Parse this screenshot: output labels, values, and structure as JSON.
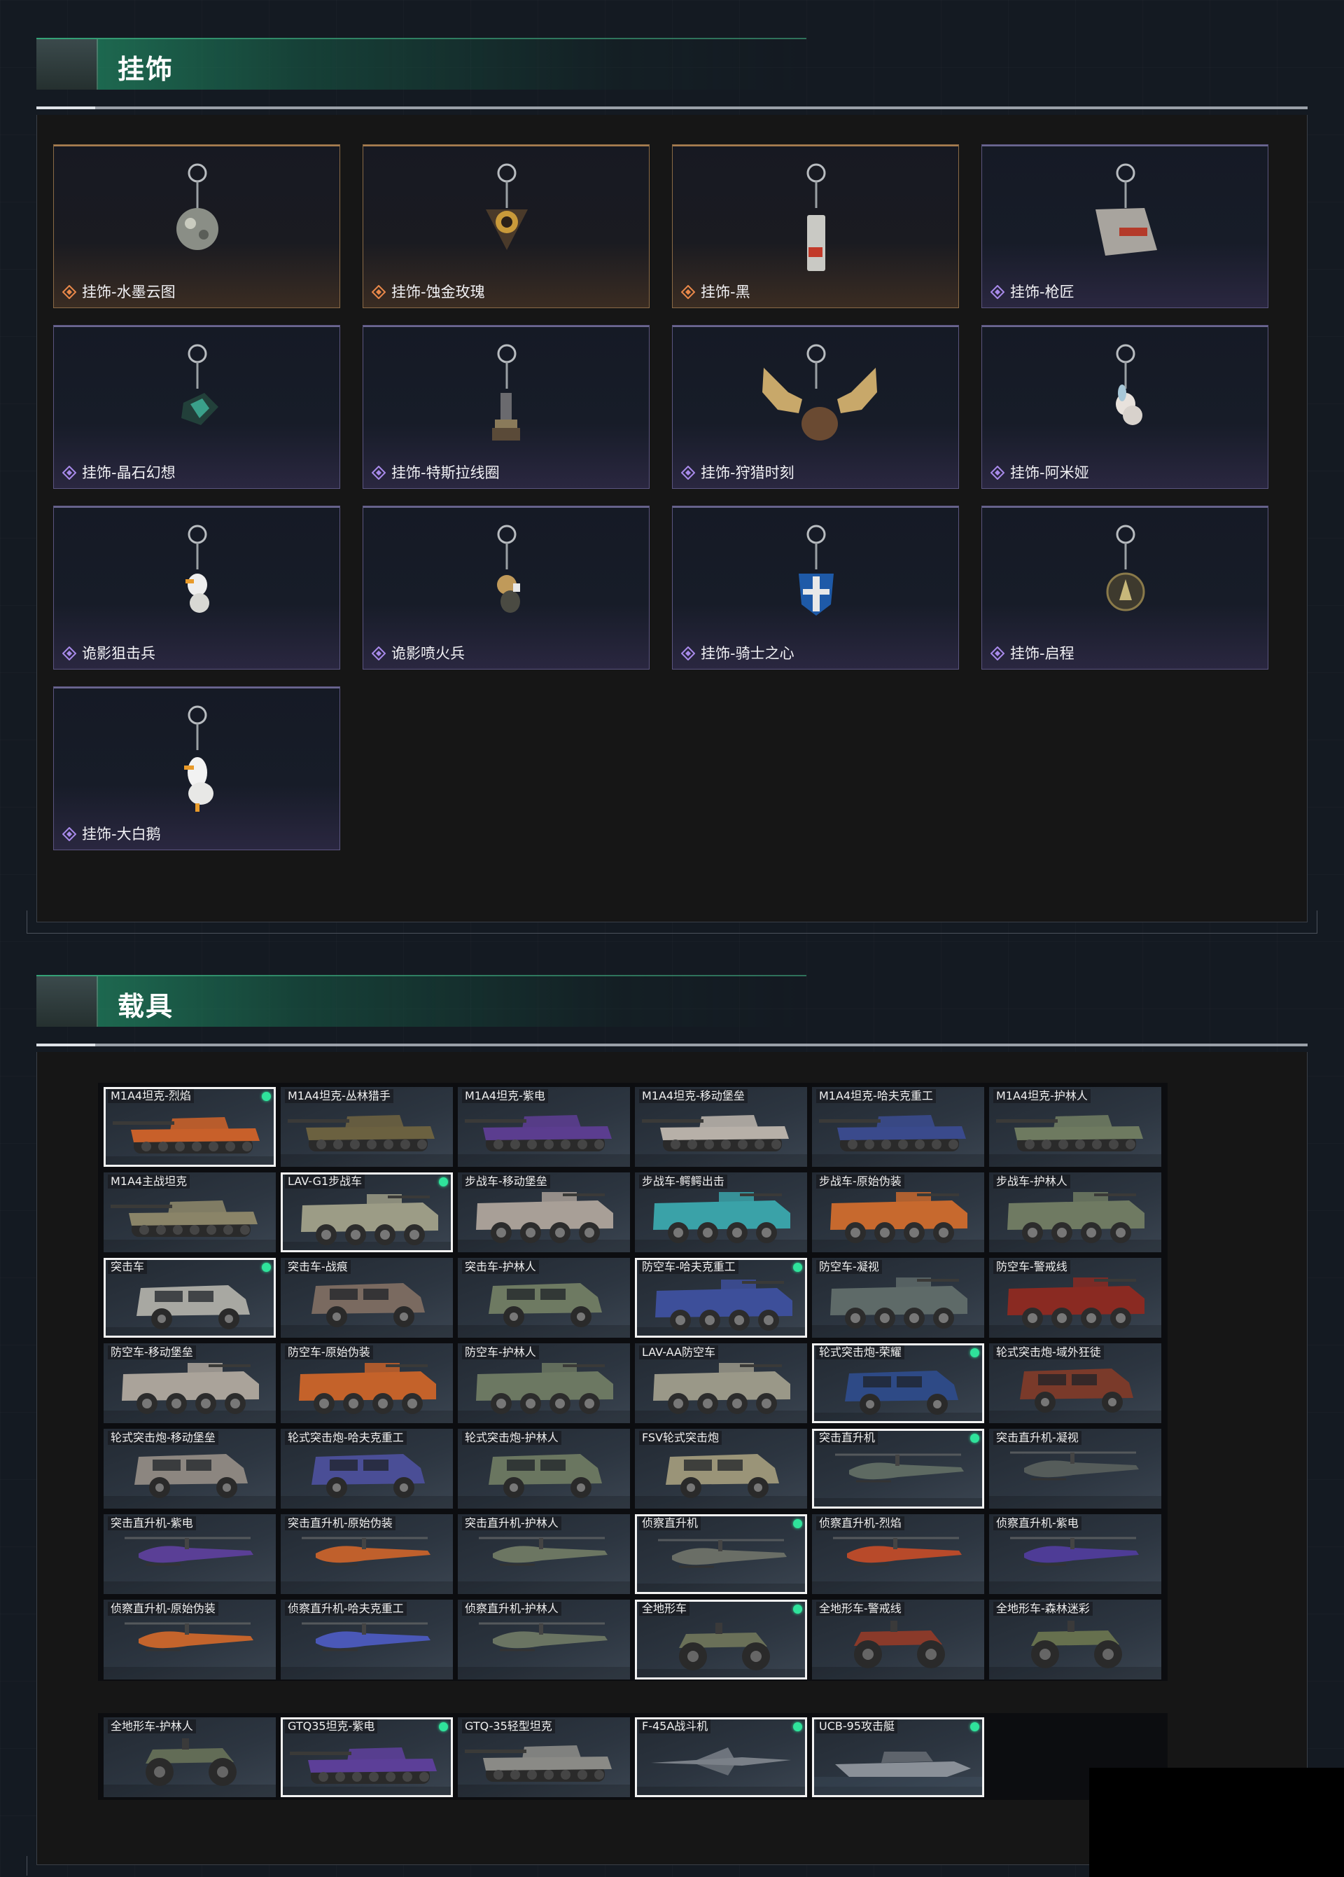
{
  "pendant_section": {
    "title": "挂饰",
    "items": [
      {
        "label": "挂饰-水墨云图",
        "rarity": "gold",
        "icon": "orb-pendant-icon"
      },
      {
        "label": "挂饰-蚀金玫瑰",
        "rarity": "gold",
        "icon": "rose-emblem-pendant-icon"
      },
      {
        "label": "挂饰-黑",
        "rarity": "gold",
        "icon": "card-pendant-icon"
      },
      {
        "label": "挂饰-枪匠",
        "rarity": "purple",
        "icon": "toolbox-pendant-icon"
      },
      {
        "label": "挂饰-晶石幻想",
        "rarity": "purple",
        "icon": "crystal-cube-pendant-icon"
      },
      {
        "label": "挂饰-特斯拉线圈",
        "rarity": "purple",
        "icon": "tesla-coil-pendant-icon"
      },
      {
        "label": "挂饰-狩猎时刻",
        "rarity": "purple",
        "icon": "moose-antler-pendant-icon"
      },
      {
        "label": "挂饰-阿米娅",
        "rarity": "purple",
        "icon": "bunny-pendant-icon"
      },
      {
        "label": "诡影狙击兵",
        "rarity": "purple",
        "icon": "goose-sniper-pendant-icon"
      },
      {
        "label": "诡影喷火兵",
        "rarity": "purple",
        "icon": "goose-flamer-pendant-icon"
      },
      {
        "label": "挂饰-骑士之心",
        "rarity": "purple",
        "icon": "shield-pendant-icon"
      },
      {
        "label": "挂饰-启程",
        "rarity": "purple",
        "icon": "medal-pendant-icon"
      },
      {
        "label": "挂饰-大白鹅",
        "rarity": "purple",
        "icon": "white-goose-pendant-icon"
      }
    ]
  },
  "vehicle_section": {
    "title": "载具",
    "rows": [
      [
        {
          "label": "M1A4坦克-烈焰",
          "selected": true,
          "owned": true,
          "kind": "tank",
          "color": "#c8602a"
        },
        {
          "label": "M1A4坦克-丛林猎手",
          "selected": false,
          "owned": false,
          "kind": "tank",
          "color": "#6b6140"
        },
        {
          "label": "M1A4坦克-紫电",
          "selected": false,
          "owned": false,
          "kind": "tank",
          "color": "#5b3d8f"
        },
        {
          "label": "M1A4坦克-移动堡垒",
          "selected": false,
          "owned": false,
          "kind": "tank",
          "color": "#b7b0a8"
        },
        {
          "label": "M1A4坦克-哈夫克重工",
          "selected": false,
          "owned": false,
          "kind": "tank",
          "color": "#3a4a8c"
        },
        {
          "label": "M1A4坦克-护林人",
          "selected": false,
          "owned": false,
          "kind": "tank",
          "color": "#6e7a60"
        }
      ],
      [
        {
          "label": "M1A4主战坦克",
          "selected": false,
          "owned": false,
          "kind": "tank",
          "color": "#8a8468"
        },
        {
          "label": "LAV-G1步战车",
          "selected": true,
          "owned": true,
          "kind": "apc",
          "color": "#9c9c86"
        },
        {
          "label": "步战车-移动堡垒",
          "selected": false,
          "owned": false,
          "kind": "apc",
          "color": "#a89f97"
        },
        {
          "label": "步战车-鳄鳄出击",
          "selected": false,
          "owned": false,
          "kind": "apc",
          "color": "#3aa2a8"
        },
        {
          "label": "步战车-原始伪装",
          "selected": false,
          "owned": false,
          "kind": "apc",
          "color": "#c7692e"
        },
        {
          "label": "步战车-护林人",
          "selected": false,
          "owned": false,
          "kind": "apc",
          "color": "#6f7a62"
        }
      ],
      [
        {
          "label": "突击车",
          "selected": true,
          "owned": true,
          "kind": "truck",
          "color": "#a8a8a2"
        },
        {
          "label": "突击车-战痕",
          "selected": false,
          "owned": false,
          "kind": "truck",
          "color": "#7a6a60"
        },
        {
          "label": "突击车-护林人",
          "selected": false,
          "owned": false,
          "kind": "truck",
          "color": "#6e7a62"
        },
        {
          "label": "防空车-哈夫克重工",
          "selected": true,
          "owned": true,
          "kind": "apc",
          "color": "#3d4f9a"
        },
        {
          "label": "防空车-凝视",
          "selected": false,
          "owned": false,
          "kind": "apc",
          "color": "#5e6a68"
        },
        {
          "label": "防空车-警戒线",
          "selected": false,
          "owned": false,
          "kind": "apc",
          "color": "#8a2a22"
        }
      ],
      [
        {
          "label": "防空车-移动堡垒",
          "selected": false,
          "owned": false,
          "kind": "apc",
          "color": "#aaa39a"
        },
        {
          "label": "防空车-原始伪装",
          "selected": false,
          "owned": false,
          "kind": "apc",
          "color": "#c4622a"
        },
        {
          "label": "防空车-护林人",
          "selected": false,
          "owned": false,
          "kind": "apc",
          "color": "#6c7862"
        },
        {
          "label": "LAV-AA防空车",
          "selected": false,
          "owned": false,
          "kind": "apc",
          "color": "#9a9888"
        },
        {
          "label": "轮式突击炮-荣耀",
          "selected": true,
          "owned": true,
          "kind": "truck",
          "color": "#2e4a86"
        },
        {
          "label": "轮式突击炮-域外狂徒",
          "selected": false,
          "owned": false,
          "kind": "truck",
          "color": "#7a3a2a"
        }
      ],
      [
        {
          "label": "轮式突击炮-移动堡垒",
          "selected": false,
          "owned": false,
          "kind": "truck",
          "color": "#8c8680"
        },
        {
          "label": "轮式突击炮-哈夫克重工",
          "selected": false,
          "owned": false,
          "kind": "truck",
          "color": "#4a4e96"
        },
        {
          "label": "轮式突击炮-护林人",
          "selected": false,
          "owned": false,
          "kind": "truck",
          "color": "#6a7660"
        },
        {
          "label": "FSV轮式突击炮",
          "selected": false,
          "owned": false,
          "kind": "truck",
          "color": "#9a9478"
        },
        {
          "label": "突击直升机",
          "selected": true,
          "owned": true,
          "kind": "heli",
          "color": "#5e6a62"
        },
        {
          "label": "突击直升机-凝视",
          "selected": false,
          "owned": false,
          "kind": "heli",
          "color": "#555c5a"
        }
      ],
      [
        {
          "label": "突击直升机-紫电",
          "selected": false,
          "owned": false,
          "kind": "heli",
          "color": "#5a3f96"
        },
        {
          "label": "突击直升机-原始伪装",
          "selected": false,
          "owned": false,
          "kind": "heli",
          "color": "#c0602c"
        },
        {
          "label": "突击直升机-护林人",
          "selected": false,
          "owned": false,
          "kind": "heli",
          "color": "#6c7662"
        },
        {
          "label": "侦察直升机",
          "selected": true,
          "owned": true,
          "kind": "heli",
          "color": "#6a6e66"
        },
        {
          "label": "侦察直升机-烈焰",
          "selected": false,
          "owned": false,
          "kind": "heli",
          "color": "#b84a2a"
        },
        {
          "label": "侦察直升机-紫电",
          "selected": false,
          "owned": false,
          "kind": "heli",
          "color": "#4e3c96"
        }
      ],
      [
        {
          "label": "侦察直升机-原始伪装",
          "selected": false,
          "owned": false,
          "kind": "heli",
          "color": "#c4642c"
        },
        {
          "label": "侦察直升机-哈夫克重工",
          "selected": false,
          "owned": false,
          "kind": "heli",
          "color": "#4a58b8"
        },
        {
          "label": "侦察直升机-护林人",
          "selected": false,
          "owned": false,
          "kind": "heli",
          "color": "#6a7462"
        },
        {
          "label": "全地形车",
          "selected": true,
          "owned": true,
          "kind": "atv",
          "color": "#6a7058"
        },
        {
          "label": "全地形车-警戒线",
          "selected": false,
          "owned": false,
          "kind": "atv",
          "color": "#8a3a2a"
        },
        {
          "label": "全地形车-森林迷彩",
          "selected": false,
          "owned": false,
          "kind": "atv",
          "color": "#66704e"
        }
      ]
    ],
    "extra_row": [
      {
        "label": "全地形车-护林人",
        "selected": false,
        "owned": false,
        "kind": "atv",
        "color": "#626c56"
      },
      {
        "label": "GTQ35坦克-紫电",
        "selected": true,
        "owned": true,
        "kind": "tank",
        "color": "#5c3f98"
      },
      {
        "label": "GTQ-35轻型坦克",
        "selected": false,
        "owned": false,
        "kind": "tank",
        "color": "#8a8a86"
      },
      {
        "label": "F-45A战斗机",
        "selected": true,
        "owned": true,
        "kind": "jet",
        "color": "#7a8088"
      },
      {
        "label": "UCB-95攻击艇",
        "selected": true,
        "owned": true,
        "kind": "boat",
        "color": "#8a9098"
      }
    ]
  }
}
